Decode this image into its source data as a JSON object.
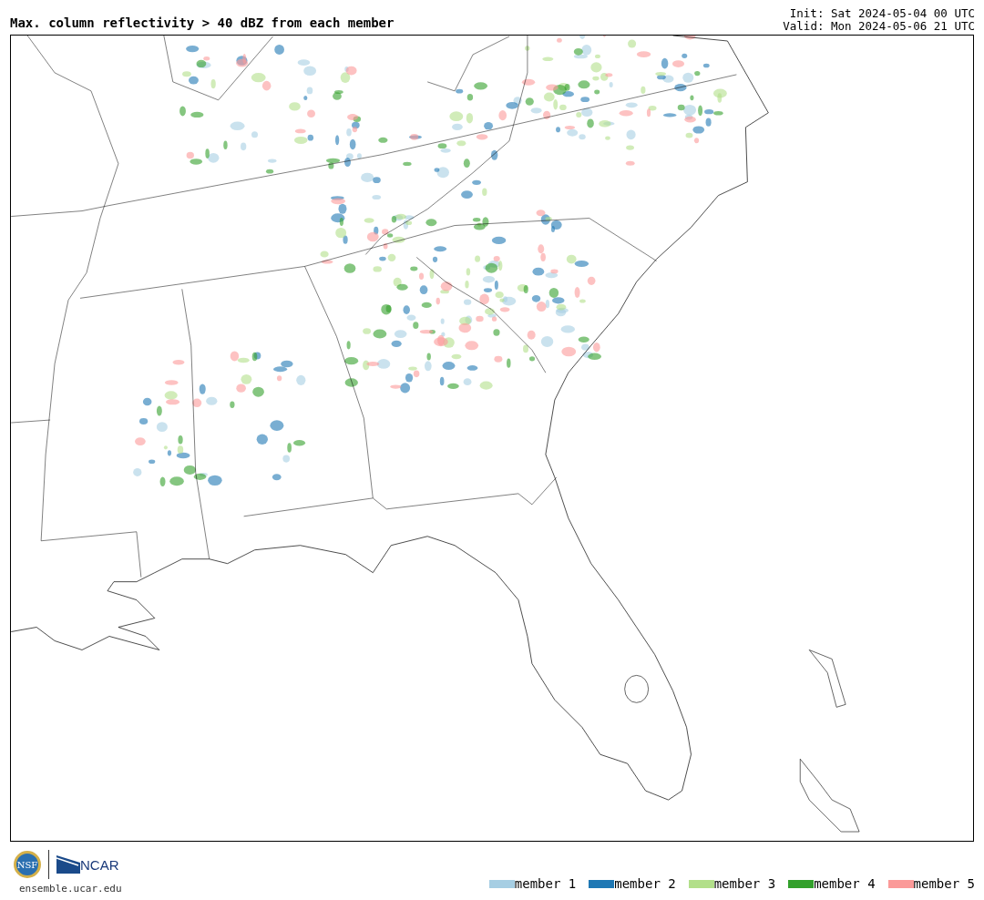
{
  "title": "Max. column reflectivity > 40 dBZ from each member",
  "init": "Init: Sat 2024-05-04 00 UTC",
  "valid": "Valid: Mon 2024-05-06 21 UTC",
  "logos": {
    "nsf": "NSF",
    "ncar": "NCAR"
  },
  "site": "ensemble.ucar.edu",
  "legend": [
    {
      "label": "member 1",
      "color": "#a6cee3"
    },
    {
      "label": "member 2",
      "color": "#1f78b4"
    },
    {
      "label": "member 3",
      "color": "#b2df8a"
    },
    {
      "label": "member 4",
      "color": "#33a02c"
    },
    {
      "label": "member 5",
      "color": "#fb9a99"
    }
  ]
}
